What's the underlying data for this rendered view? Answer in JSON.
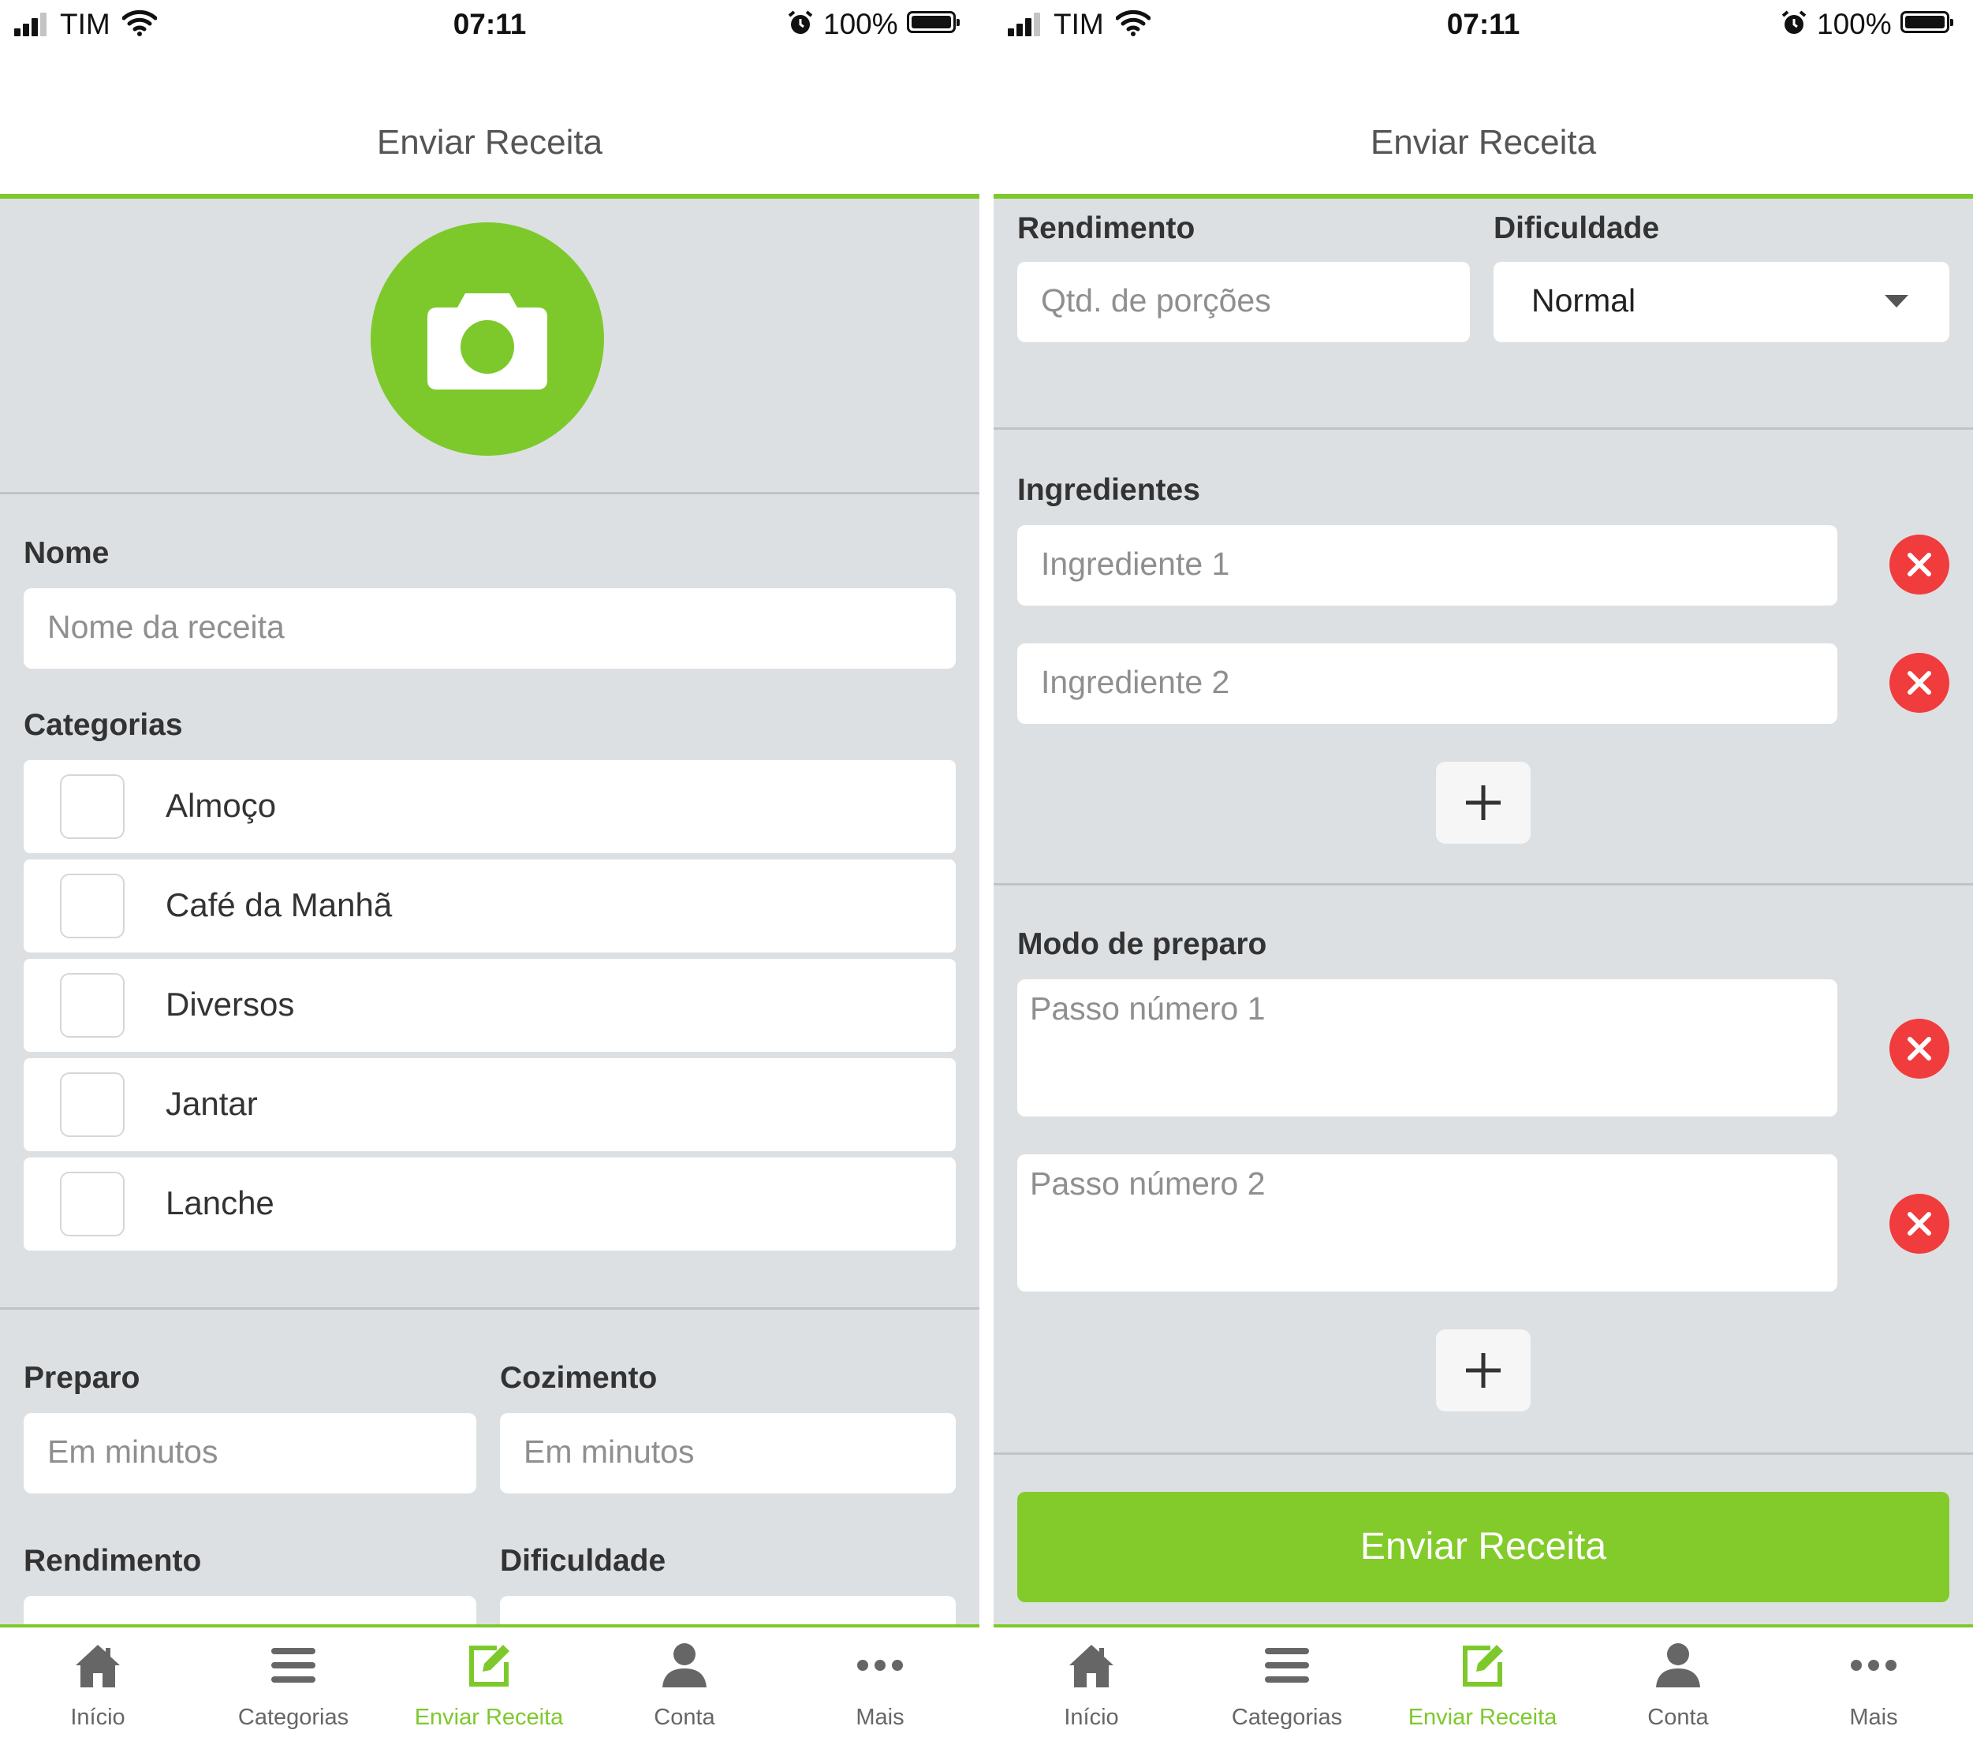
{
  "status_bar": {
    "carrier": "TIM",
    "time": "07:11",
    "battery": "100%"
  },
  "nav": {
    "title": "Enviar Receita"
  },
  "form": {
    "nome": {
      "label": "Nome",
      "placeholder": "Nome da receita"
    },
    "categorias": {
      "label": "Categorias",
      "items": [
        "Almoço",
        "Café da Manhã",
        "Diversos",
        "Jantar",
        "Lanche"
      ]
    },
    "preparo": {
      "label": "Preparo",
      "placeholder": "Em minutos"
    },
    "cozimento": {
      "label": "Cozimento",
      "placeholder": "Em minutos"
    },
    "rendimento": {
      "label": "Rendimento",
      "placeholder": "Qtd. de porções"
    },
    "dificuldade": {
      "label": "Dificuldade",
      "value": "Normal"
    },
    "ingredientes": {
      "label": "Ingredientes",
      "items": [
        "Ingrediente 1",
        "Ingrediente 2"
      ]
    },
    "modo_preparo": {
      "label": "Modo de preparo",
      "items": [
        "Passo número 1",
        "Passo número 2"
      ]
    },
    "submit_label": "Enviar Receita"
  },
  "tabs": [
    {
      "label": "Início",
      "icon": "home-icon"
    },
    {
      "label": "Categorias",
      "icon": "list-icon"
    },
    {
      "label": "Enviar Receita",
      "icon": "edit-icon",
      "active": true
    },
    {
      "label": "Conta",
      "icon": "user-icon"
    },
    {
      "label": "Mais",
      "icon": "more-icon"
    }
  ],
  "colors": {
    "accent": "#7dc92b",
    "remove": "#f03c3c",
    "background": "#dde0e3"
  }
}
